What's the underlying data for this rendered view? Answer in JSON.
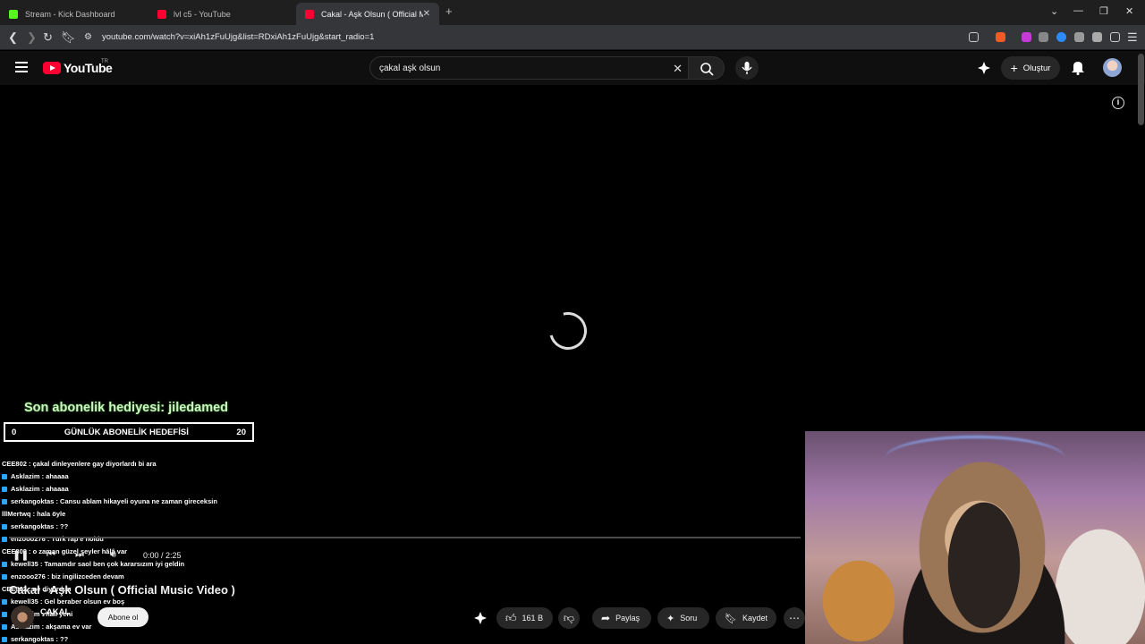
{
  "browser": {
    "tabs": [
      {
        "title": "Stream - Kick Dashboard",
        "favicon_color": "#53fc18"
      },
      {
        "title": "lvl c5 - YouTube",
        "favicon_color": "#ff0033"
      },
      {
        "title": "Cakal - Aşk Olsun ( Official Musi",
        "favicon_color": "#ff0033"
      }
    ],
    "url": "youtube.com/watch?v=xiAh1zFuUjg&list=RDxiAh1zFuUjg&start_radio=1"
  },
  "youtube": {
    "logo_text": "YouTube",
    "country_code": "TR",
    "search_value": "çakal aşk olsun",
    "create_label": "Oluştur"
  },
  "overlay": {
    "sub_gift": "Son abonelik hediyesi: jiledamed",
    "goal_start": "0",
    "goal_label": "GÜNLÜK ABONELİK HEDEFİSİ",
    "goal_end": "20",
    "chat": [
      {
        "text": "CEE802 : çakal dinleyenlere gay diyorlardı bi ara",
        "badge": false
      },
      {
        "text": "Asklazim : ahaaaa",
        "badge": true
      },
      {
        "text": "Asklazim : ahaaaa",
        "badge": true
      },
      {
        "text": "serkangoktas : Cansu ablam hikayeli oyuna ne zaman gireceksin",
        "badge": true
      },
      {
        "text": "lllMertwq : hala öyle",
        "badge": false
      },
      {
        "text": "serkangoktas : ??",
        "badge": true
      },
      {
        "text": "enzooo276 : Türk rap'e noldu",
        "badge": true
      },
      {
        "text": "CEE802 : o zaman güzel şeyler hâlâ var",
        "badge": false
      },
      {
        "text": "kewell35 : Tamamdır saol ben çok kararsızım iyi geldin",
        "badge": true
      },
      {
        "text": "enzooo276 : biz ingilizceden devam",
        "badge": true
      },
      {
        "text": "CEE802 : ne diyordun",
        "badge": false
      },
      {
        "text": "kewell35 : Gel beraber olsun ev boş",
        "badge": true
      },
      {
        "text": "Asklazim : hali yeni",
        "badge": true
      },
      {
        "text": "Asklazim : akşama ev var",
        "badge": true
      },
      {
        "text": "serkangoktas : ??",
        "badge": true
      }
    ]
  },
  "player": {
    "time": "0:00 / 2:25",
    "title": "Cakal - Aşk Olsun ( Official Music Video )",
    "channel": "ÇAKAL",
    "subscribe_label": "Abone ol",
    "like_count": "161 B",
    "share_label": "Paylaş",
    "ask_label": "Soru",
    "save_label": "Kaydet"
  }
}
